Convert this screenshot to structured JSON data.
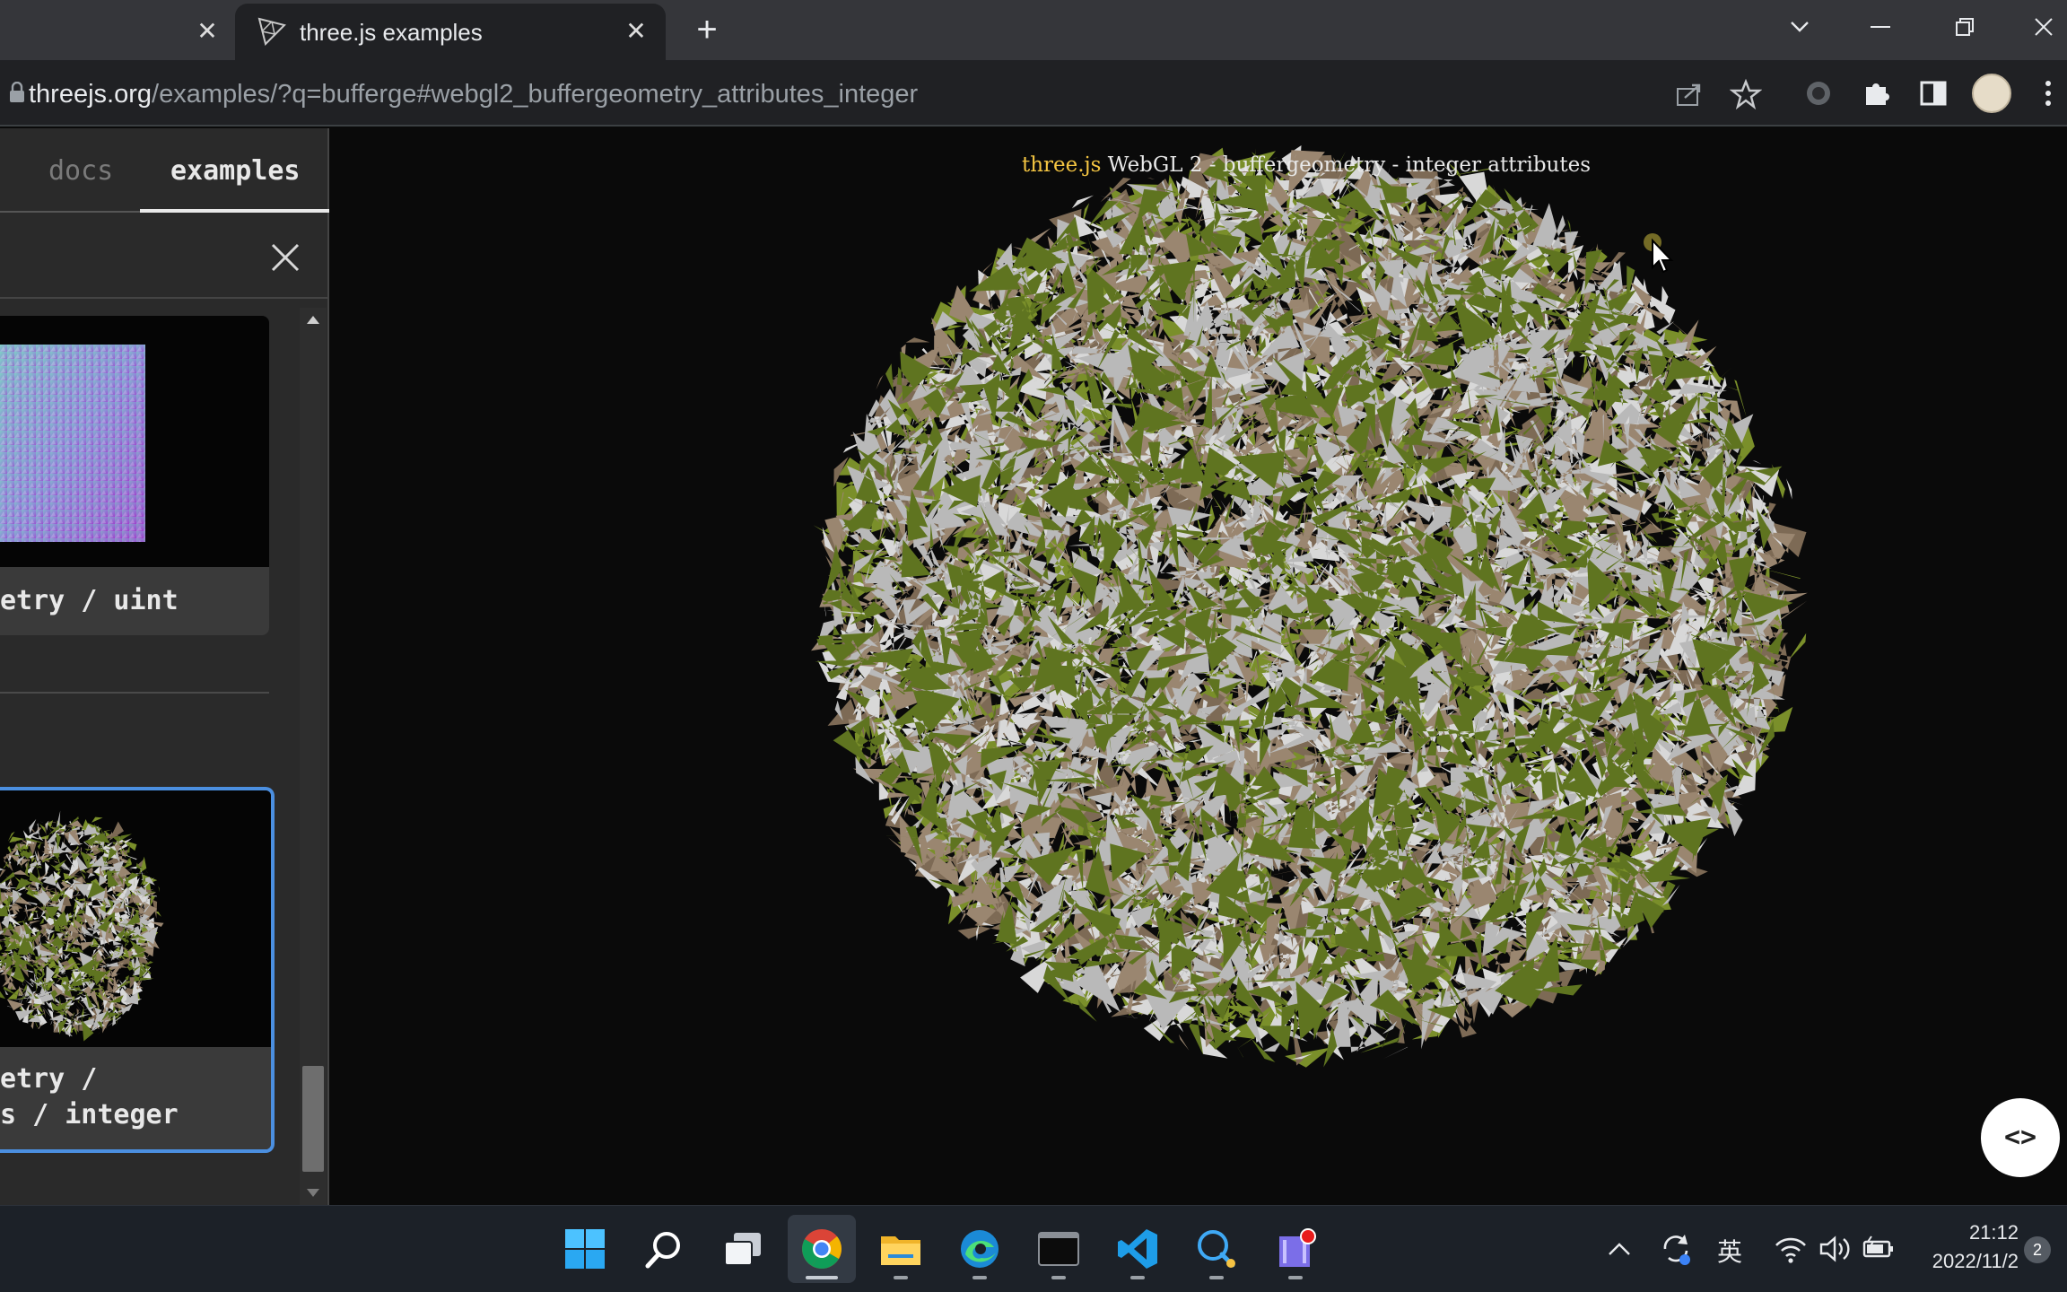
{
  "browser": {
    "active_tab_title": "three.js examples",
    "url_host": "threejs.org",
    "url_rest": "/examples/?q=bufferge#webgl2_buffergeometry_attributes_integer",
    "new_tab_label": "+"
  },
  "sidebar": {
    "tabs": [
      {
        "label": "docs",
        "active": false
      },
      {
        "label": "examples",
        "active": true
      }
    ],
    "cards": [
      {
        "caption": "etry / uint",
        "selected": false
      },
      {
        "caption_line1": "etry /",
        "caption_line2": "s / integer",
        "selected": true
      }
    ]
  },
  "viewport": {
    "info_link": "three.js",
    "info_text": " WebGL 2 - buffergeometry - integer attributes",
    "code_button": "<>"
  },
  "taskbar": {
    "tray_input_method": "英",
    "time": "21:12",
    "date": "2022/11/2",
    "notification_count": "2"
  },
  "colors": {
    "accent_selected": "#4b8fe0",
    "triangle_green": "#7a8f2a",
    "triangle_brown": "#7d6a55",
    "triangle_white": "#d8d8d8",
    "info_link": "#f4c542"
  }
}
